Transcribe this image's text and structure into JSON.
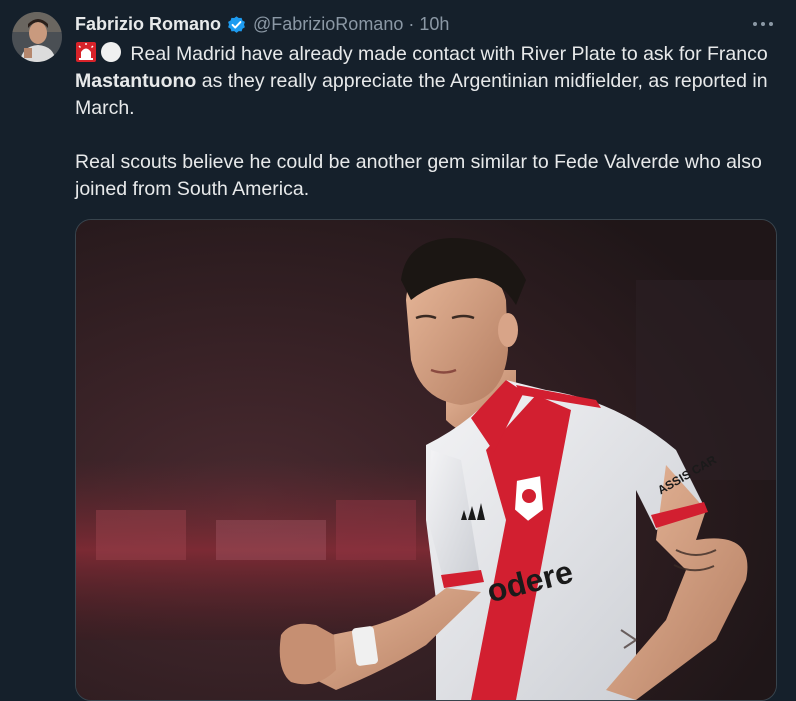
{
  "author": {
    "name": "Fabrizio Romano",
    "handle": "@FabrizioRomano",
    "separator": "·",
    "time": "10h",
    "verified": true
  },
  "tweet": {
    "emojis": [
      "siren-emoji",
      "white-circle-emoji"
    ],
    "line1_text": " Real Madrid have already made contact with River Plate to ask for Franco ",
    "line1_bold": "Mastantuono",
    "line1_tail": " as they really appreciate the Argentinian midfielder, as reported in March.",
    "paragraph2": "Real scouts believe he could be another gem similar to Fede Valverde who also joined from South America."
  },
  "media": {
    "sponsor_text": "odere",
    "sleeve_text": "ASSIS CAR"
  },
  "colors": {
    "background": "#15202b",
    "verified_blue": "#1d9bf0",
    "muted_text": "#8b98a5",
    "jersey_red": "#d21f30"
  }
}
